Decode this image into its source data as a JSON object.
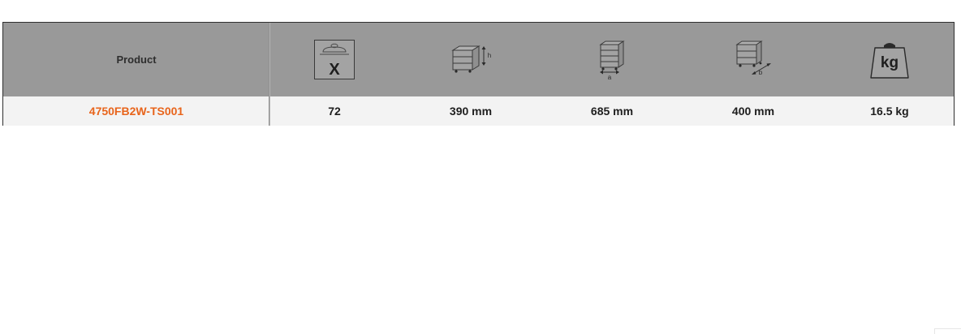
{
  "table": {
    "header": {
      "product_label": "Product",
      "icons": [
        {
          "name": "quantity-icon",
          "glyph": "X"
        },
        {
          "name": "height-icon",
          "label": "h"
        },
        {
          "name": "width-icon",
          "label": "a"
        },
        {
          "name": "depth-icon",
          "label": "b"
        },
        {
          "name": "weight-icon",
          "label": "kg"
        }
      ]
    },
    "rows": [
      {
        "product": "4750FB2W-TS001",
        "quantity": "72",
        "height": "390 mm",
        "width": "685 mm",
        "depth": "400 mm",
        "weight": "16.5 kg"
      }
    ]
  },
  "colors": {
    "header_bg": "#999999",
    "row_bg": "#f3f3f3",
    "link": "#e8641b"
  }
}
